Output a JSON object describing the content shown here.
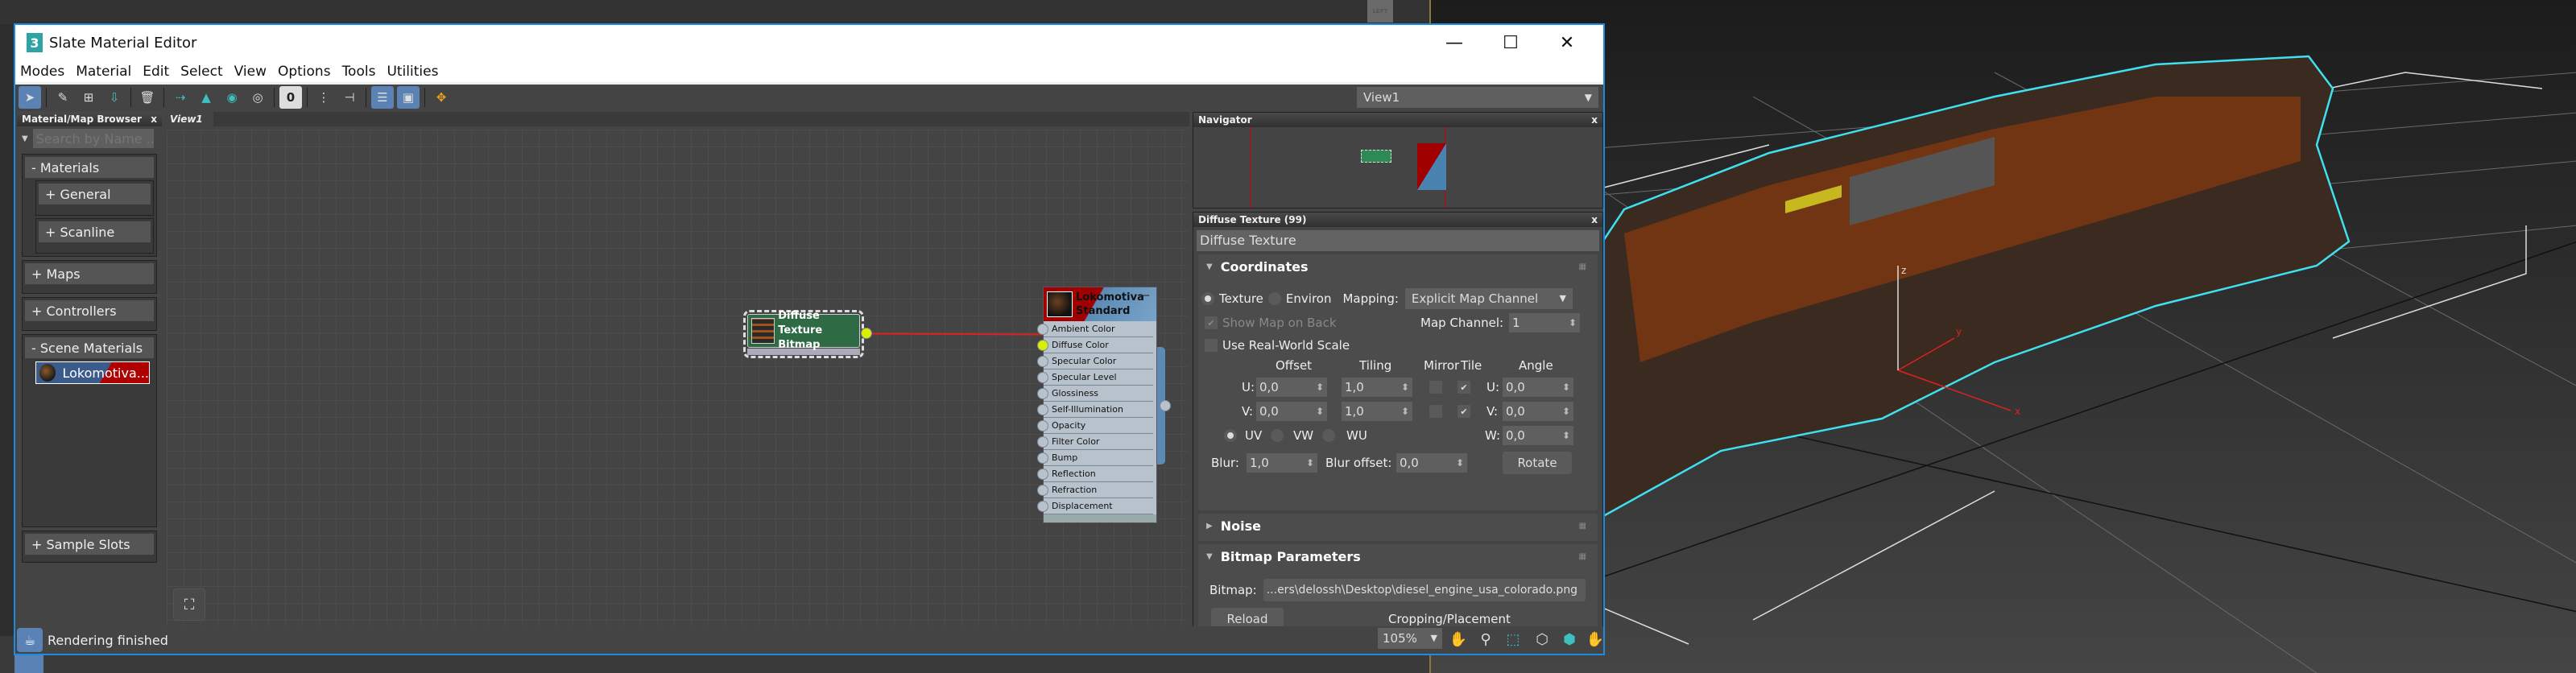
{
  "background": {
    "viewcube_label": "LEFT",
    "viewport_axes": {
      "x": "x",
      "y": "y",
      "z": "z"
    }
  },
  "window": {
    "title": "Slate Material Editor",
    "app_icon": "3",
    "controls": {
      "minimize": "—",
      "maximize": "☐",
      "close": "✕"
    }
  },
  "menu": [
    "Modes",
    "Material",
    "Edit",
    "Select",
    "View",
    "Options",
    "Tools",
    "Utilities"
  ],
  "toolbar": {
    "icons": [
      "select-arrow-icon",
      "eyedropper-icon",
      "put-to-scene-icon",
      "assign-to-selection-icon",
      "delete-icon",
      "move-children-icon",
      "hide-unused-slots-icon",
      "show-map-in-viewport-icon",
      "show-background-icon",
      "material-id-icon",
      "layout-all-icon",
      "layout-children-icon",
      "material-map-browser-toggle-icon",
      "parameter-editor-toggle-icon",
      "select-by-material-icon"
    ],
    "material_id_label": "0",
    "view_select": "View1"
  },
  "browser": {
    "title": "Material/Map Browser",
    "close": "x",
    "search_placeholder": "Search by Name ...",
    "groups": {
      "materials": "- Materials",
      "general": "+ General",
      "scanline": "+ Scanline",
      "maps": "+ Maps",
      "controllers": "+ Controllers",
      "scene_materials": "- Scene Materials",
      "scene_item": "Lokomotiva...",
      "sample_slots": "+ Sample Slots"
    }
  },
  "view": {
    "tab": "View1",
    "bitmap_node": {
      "title": "Diffuse Texture",
      "type": "Bitmap"
    },
    "standard_node": {
      "title": "Lokomotiva",
      "type": "Standard",
      "minimize": "—",
      "slots": [
        "Ambient Color",
        "Diffuse Color",
        "Specular Color",
        "Specular Level",
        "Glossiness",
        "Self-Illumination",
        "Opacity",
        "Filter Color",
        "Bump",
        "Reflection",
        "Refraction",
        "Displacement"
      ],
      "connected_slot": "Diffuse Color"
    }
  },
  "navigator": {
    "title": "Navigator",
    "close": "x"
  },
  "params": {
    "title": "Diffuse Texture (99)",
    "close": "x",
    "name": "Diffuse Texture",
    "coordinates": {
      "title": "Coordinates",
      "texture_label": "Texture",
      "environ_label": "Environ",
      "mapping_label": "Mapping:",
      "mapping_value": "Explicit Map Channel",
      "show_map_on_back": "Show Map on Back",
      "map_channel_label": "Map Channel:",
      "map_channel_value": "1",
      "real_world_scale": "Use Real-World Scale",
      "headers": {
        "offset": "Offset",
        "tiling": "Tiling",
        "mirror": "Mirror",
        "tile": "Tile",
        "angle": "Angle"
      },
      "u_label": "U:",
      "v_label": "V:",
      "w_label": "W:",
      "offset_u": "0,0",
      "offset_v": "0,0",
      "tiling_u": "1,0",
      "tiling_v": "1,0",
      "angle_u": "0,0",
      "angle_v": "0,0",
      "angle_w": "0,0",
      "uv": "UV",
      "vw": "VW",
      "wu": "WU",
      "blur_label": "Blur:",
      "blur_value": "1,0",
      "blur_offset_label": "Blur offset:",
      "blur_offset_value": "0,0",
      "rotate": "Rotate"
    },
    "noise": {
      "title": "Noise"
    },
    "bitmap_params": {
      "title": "Bitmap Parameters",
      "bitmap_label": "Bitmap:",
      "bitmap_path": "...ers\\delossh\\Desktop\\diesel_engine_usa_colorado.png",
      "reload": "Reload",
      "cropping": "Cropping/Placement"
    }
  },
  "status": {
    "text": "Rendering finished",
    "zoom": "105%"
  },
  "colors": {
    "accent": "#5b82b5",
    "window_border": "#1d8ce0",
    "bitmap_node": "#2e6b45",
    "wire": "#e02020",
    "socket_active": "#d8f000",
    "selection_outline": "#3fe0f0"
  }
}
